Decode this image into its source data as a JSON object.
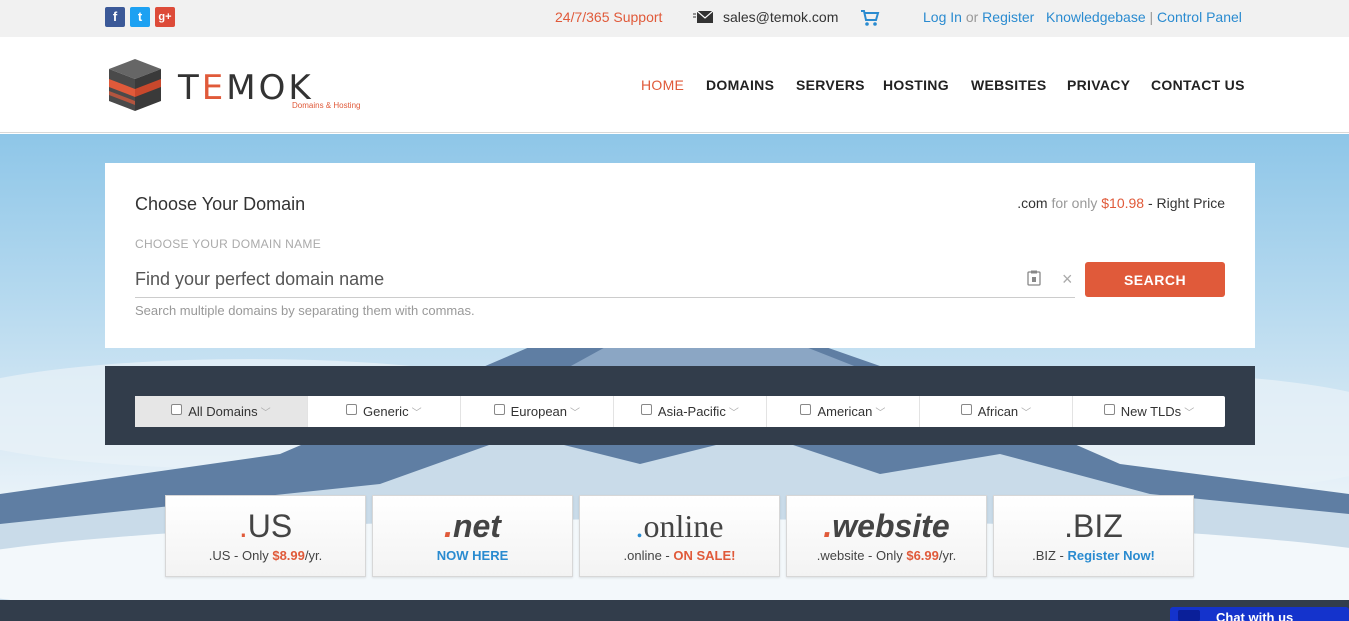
{
  "topbar": {
    "social": {
      "facebook": "f",
      "twitter": "t",
      "google": "g+"
    },
    "support": "24/7/365 Support",
    "email": "sales@temok.com",
    "login": "Log In",
    "or": "or",
    "register": "Register",
    "knowledgebase": "Knowledgebase",
    "separator": "|",
    "control_panel": "Control Panel"
  },
  "header": {
    "logo_pre": "T",
    "logo_e": "E",
    "logo_post": "MOK",
    "tagline": "Domains & Hosting",
    "nav": [
      "HOME",
      "DOMAINS",
      "SERVERS",
      "HOSTING",
      "WEBSITES",
      "PRIVACY",
      "CONTACT US"
    ]
  },
  "search": {
    "title": "Choose Your Domain",
    "promo_tld": ".com",
    "promo_for": "for only",
    "promo_price": "$10.98",
    "promo_tail": "- Right Price",
    "label": "CHOOSE YOUR DOMAIN NAME",
    "placeholder": "Find your perfect domain name",
    "button": "SEARCH",
    "hint": "Search multiple domains by separating them with commas."
  },
  "filters": [
    "All Domains",
    "Generic",
    "European",
    "Asia-Pacific",
    "American",
    "African",
    "New TLDs"
  ],
  "tlds": [
    {
      "dot": ".",
      "name": "US",
      "sub_pre": ".US - Only ",
      "sub_hl": "$8.99",
      "sub_post": "/yr."
    },
    {
      "dot": ".",
      "name": "net",
      "sub_pre": "",
      "sub_hl": "NOW HERE",
      "sub_post": ""
    },
    {
      "dot": ".",
      "name": "online",
      "sub_pre": ".online - ",
      "sub_hl": "ON SALE!",
      "sub_post": ""
    },
    {
      "dot": ".",
      "name": "website",
      "sub_pre": ".website - Only ",
      "sub_hl": "$6.99",
      "sub_post": "/yr."
    },
    {
      "dot": ".",
      "name": "BIZ",
      "sub_pre": ".BIZ - ",
      "sub_hl": "Register Now!",
      "sub_post": ""
    }
  ],
  "chat": {
    "label": "Chat with us"
  },
  "colors": {
    "accent": "#e05a3a",
    "link": "#2a8bd0",
    "dark": "#323d4b"
  }
}
